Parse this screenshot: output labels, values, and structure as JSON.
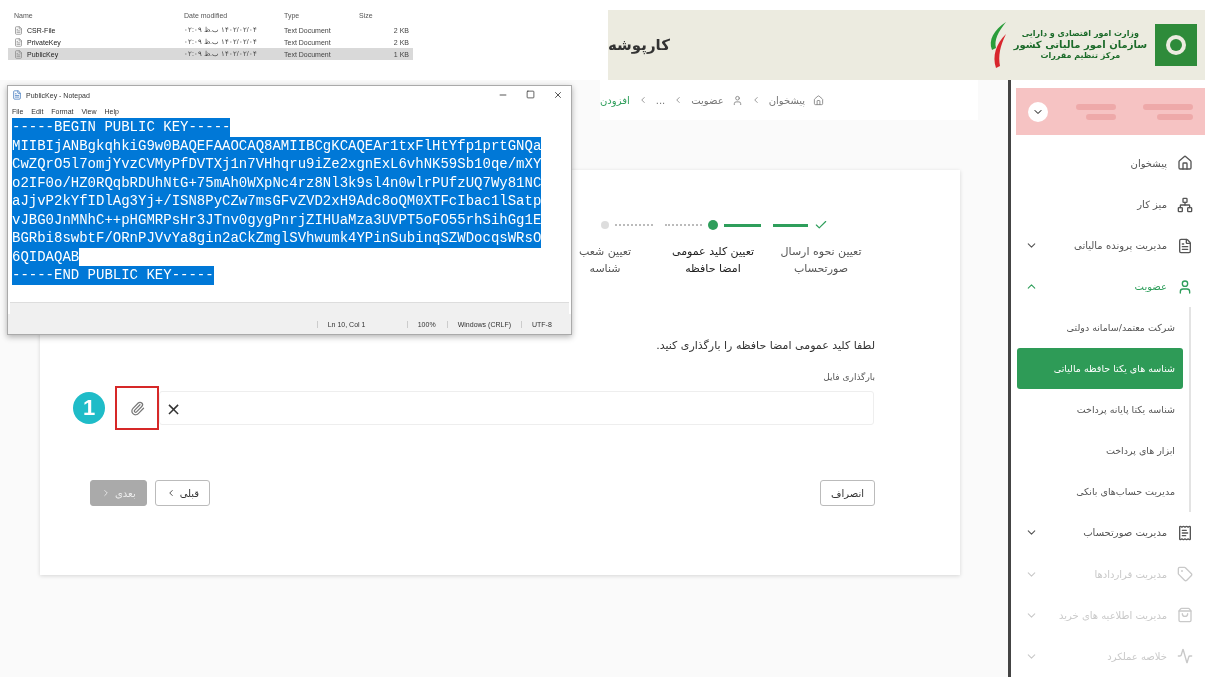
{
  "explorer": {
    "header": {
      "name": "Name",
      "date": "Date modified",
      "type": "Type",
      "size": "Size"
    },
    "files": [
      {
        "name": "CSR-File",
        "date": "۱۴۰۲/۰۲/۰۴ ب.ظ ۰۲:۰۹",
        "type": "Text Document",
        "size": "2 KB",
        "selected": false
      },
      {
        "name": "PrivateKey",
        "date": "۱۴۰۲/۰۲/۰۴ ب.ظ ۰۲:۰۹",
        "type": "Text Document",
        "size": "2 KB",
        "selected": false
      },
      {
        "name": "PublicKey",
        "date": "۱۴۰۲/۰۲/۰۴ ب.ظ ۰۲:۰۹",
        "type": "Text Document",
        "size": "1 KB",
        "selected": true
      }
    ]
  },
  "notepad": {
    "title": "PublicKey - Notepad",
    "menu": {
      "file": "File",
      "edit": "Edit",
      "format": "Format",
      "view": "View",
      "help": "Help"
    },
    "lines": [
      "-----BEGIN PUBLIC KEY-----",
      "MIIBIjANBgkqhkiG9w0BAQEFAAOCAQ8AMIIBCgKCAQEAr1txFlHtYfp1prtGNQa",
      "CwZQrO5l7omjYvzCVMyPfDVTXj1n7VHhqru9iZe2xgnExL6vhNK59Sb10qe/mXY",
      "o2IF0o/HZ0RQqbRDUhNtG+75mAh0WXpNc4rz8Nl3k9sl4n0wlrPUfzUQ7Wy81NC",
      "aJjvP2kYfIDlAg3Yj+/ISN8PyCZw7msGFvZVD2xH9Adc8oQM0XTFcIbac1lSatp",
      "vJBG0JnMNhC++pHGMRPsHr3JTnv0gygPnrjZIHUaMza3UVPT5oFO55rhSihGg1E",
      "BGRbi8swbtF/ORnPJVvYa8gin2aCkZmglSVhwumk4YPinSubinqSZWDocqsWRsO",
      "6QIDAQAB",
      "-----END PUBLIC KEY-----"
    ],
    "status": {
      "position": "Ln 10, Col 1",
      "zoom": "100%",
      "line_ending": "Windows (CRLF)",
      "encoding": "UTF-8"
    }
  },
  "header": {
    "title": "کارپوشه",
    "logo_lines": [
      "وزارت امور اقتصادی و دارایی",
      "سازمان امور مالیاتی کشور",
      "مرکز تنظیم مقررات"
    ]
  },
  "breadcrumb": [
    {
      "label": "پیشخوان",
      "kind": "home"
    },
    {
      "label": "عضویت",
      "kind": "user"
    },
    {
      "label": "...",
      "kind": "plain"
    },
    {
      "label": "افزودن",
      "kind": "current"
    }
  ],
  "stepper": [
    {
      "label": "تعیین نحوه ارسال صورتحساب",
      "completed": true,
      "active": false
    },
    {
      "label": "تعیین کلید عمومی امضا حافظه",
      "completed": false,
      "active": true
    },
    {
      "label": "تعیین شعب شناسه",
      "completed": false,
      "active": false
    }
  ],
  "instruction": "لطفا کلید عمومی امضا حافظه را بارگذاری کنید.",
  "upload": {
    "label": "بارگذاری فایل",
    "callout": "1",
    "clear": "×"
  },
  "buttons": {
    "cancel": "انصراف",
    "prev": {
      "label": "قبلی",
      "disabled": false
    },
    "next": {
      "label": "بعدی",
      "disabled": true
    }
  },
  "sidebar": {
    "items": [
      {
        "label": "پیشخوان",
        "disabled": false
      },
      {
        "label": "میز کار",
        "disabled": false
      },
      {
        "label": "مدیریت پرونده مالیاتی",
        "disabled": false,
        "expanded": false
      },
      {
        "label": "عضویت",
        "disabled": false,
        "expanded": true,
        "children": [
          {
            "label": "شرکت معتمد/سامانه دولتی",
            "selected": false
          },
          {
            "label": "شناسه های یکتا حافظه مالیاتی",
            "selected": true
          },
          {
            "label": "شناسه یکتا پایانه پرداخت",
            "selected": false
          },
          {
            "label": "ابزار های پرداخت",
            "selected": false
          },
          {
            "label": "مدیریت حساب‌های بانکی",
            "selected": false
          }
        ]
      },
      {
        "label": "مدیریت صورتحساب",
        "disabled": false,
        "expanded": false
      },
      {
        "label": "مدیریت قراردادها",
        "disabled": true,
        "expanded": false
      },
      {
        "label": "مدیریت اطلاعیه های خرید",
        "disabled": true,
        "expanded": false
      },
      {
        "label": "خلاصه عملکرد",
        "disabled": true,
        "expanded": false
      }
    ]
  }
}
